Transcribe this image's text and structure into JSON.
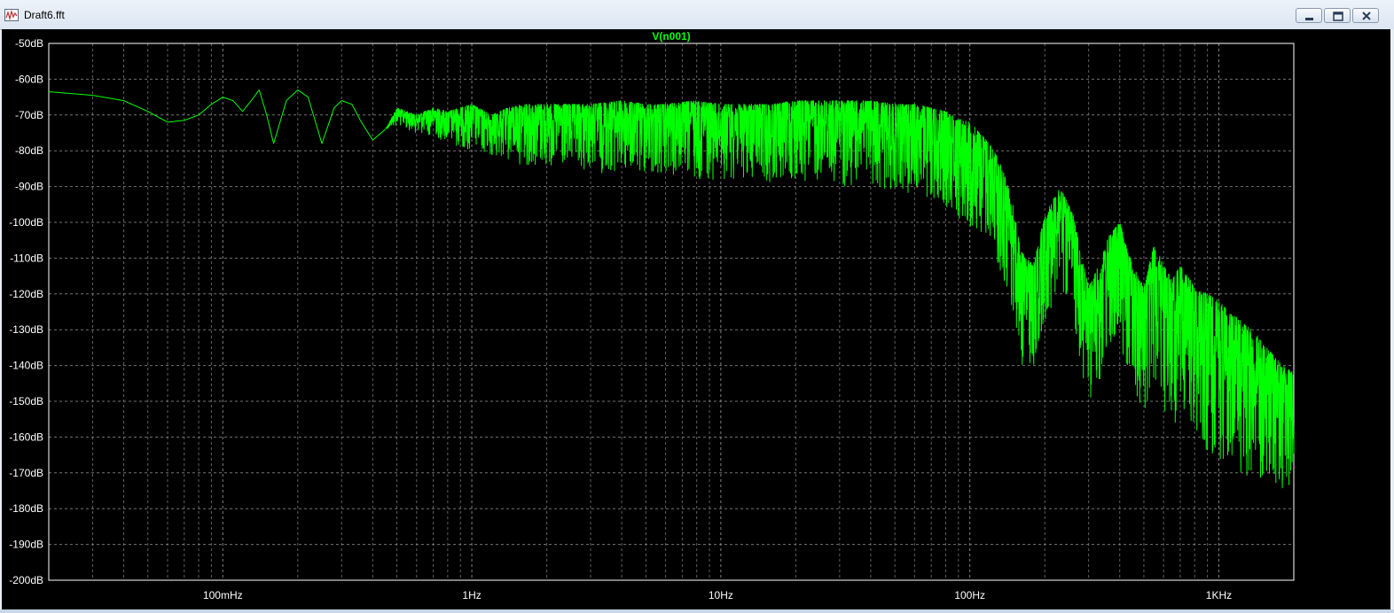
{
  "window": {
    "title": "Draft6.fft",
    "minimize_icon": "minimize-icon",
    "restore_icon": "restore-icon",
    "close_icon": "close-icon"
  },
  "chart_data": {
    "type": "line",
    "title": "V(n001)",
    "xlabel": "",
    "ylabel": "",
    "x_scale": "log",
    "xlim": [
      0.02,
      2000
    ],
    "ylim": [
      -200,
      -50
    ],
    "x_ticks": [
      {
        "value": 0.1,
        "label": "100mHz"
      },
      {
        "value": 1,
        "label": "1Hz"
      },
      {
        "value": 10,
        "label": "10Hz"
      },
      {
        "value": 100,
        "label": "100Hz"
      },
      {
        "value": 1000,
        "label": "1KHz"
      }
    ],
    "y_ticks": [
      -50,
      -60,
      -70,
      -80,
      -90,
      -100,
      -110,
      -120,
      -130,
      -140,
      -150,
      -160,
      -170,
      -180,
      -190,
      -200
    ],
    "y_tick_labels": [
      "-50dB",
      "-60dB",
      "-70dB",
      "-80dB",
      "-90dB",
      "-100dB",
      "-110dB",
      "-120dB",
      "-130dB",
      "-140dB",
      "-150dB",
      "-160dB",
      "-170dB",
      "-180dB",
      "-190dB",
      "-200dB"
    ],
    "grid": true,
    "colors": {
      "trace": "#00ff00",
      "background": "#000000",
      "grid": "#8a8a8a",
      "axis_text": "#000000"
    },
    "series": [
      {
        "name": "V(n001)",
        "x": [
          0.02,
          0.03,
          0.04,
          0.05,
          0.06,
          0.07,
          0.08,
          0.09,
          0.1,
          0.11,
          0.12,
          0.13,
          0.14,
          0.15,
          0.16,
          0.18,
          0.2,
          0.22,
          0.25,
          0.28,
          0.3,
          0.33,
          0.36,
          0.4,
          0.45,
          0.5,
          0.6,
          0.7,
          0.8,
          1.0,
          1.2,
          1.4,
          1.6,
          2.0,
          2.5,
          3,
          4,
          5,
          6,
          8,
          10,
          13,
          16,
          20,
          25,
          30,
          40,
          50,
          60,
          70,
          80,
          90,
          100,
          110,
          120,
          130,
          140,
          150,
          160,
          180,
          200,
          230,
          260,
          300,
          330,
          360,
          400,
          450,
          500,
          550,
          600,
          650,
          700,
          800,
          900,
          1000,
          1100,
          1200,
          1400,
          1600,
          1800,
          2000
        ],
        "values": [
          -63.5,
          -64.5,
          -66,
          -69,
          -72,
          -71.5,
          -70,
          -67,
          -65,
          -66,
          -69,
          -66,
          -63,
          -70,
          -78,
          -66,
          -63,
          -65,
          -78,
          -68,
          -66,
          -67,
          -72,
          -77,
          -74,
          -68,
          -70,
          -68,
          -69,
          -67,
          -70,
          -68,
          -67,
          -67,
          -67,
          -67,
          -66,
          -67,
          -67,
          -66,
          -67,
          -67,
          -67,
          -66,
          -66,
          -66,
          -66,
          -67,
          -67,
          -68,
          -69,
          -71,
          -72,
          -75,
          -78,
          -82,
          -88,
          -96,
          -108,
          -112,
          -98,
          -90,
          -98,
          -118,
          -112,
          -104,
          -100,
          -112,
          -118,
          -106,
          -112,
          -116,
          -112,
          -118,
          -120,
          -122,
          -125,
          -127,
          -131,
          -136,
          -140,
          -142
        ]
      }
    ],
    "series_band_low": [
      -63.5,
      -64.5,
      -66,
      -69,
      -72,
      -71.5,
      -70,
      -67,
      -65,
      -66,
      -69,
      -66,
      -63,
      -70,
      -78,
      -66,
      -63,
      -65,
      -78,
      -68,
      -66,
      -67,
      -72,
      -77,
      -74,
      -73,
      -75,
      -76,
      -78,
      -80,
      -82,
      -83,
      -84,
      -85,
      -86,
      -86,
      -87,
      -87,
      -88,
      -88,
      -88,
      -88,
      -89,
      -89,
      -89,
      -90,
      -90,
      -91,
      -92,
      -94,
      -96,
      -99,
      -101,
      -104,
      -108,
      -113,
      -120,
      -128,
      -140,
      -142,
      -128,
      -118,
      -128,
      -152,
      -146,
      -138,
      -134,
      -146,
      -158,
      -146,
      -152,
      -158,
      -154,
      -160,
      -164,
      -166,
      -168,
      -170,
      -172,
      -174,
      -176,
      -178
    ]
  }
}
